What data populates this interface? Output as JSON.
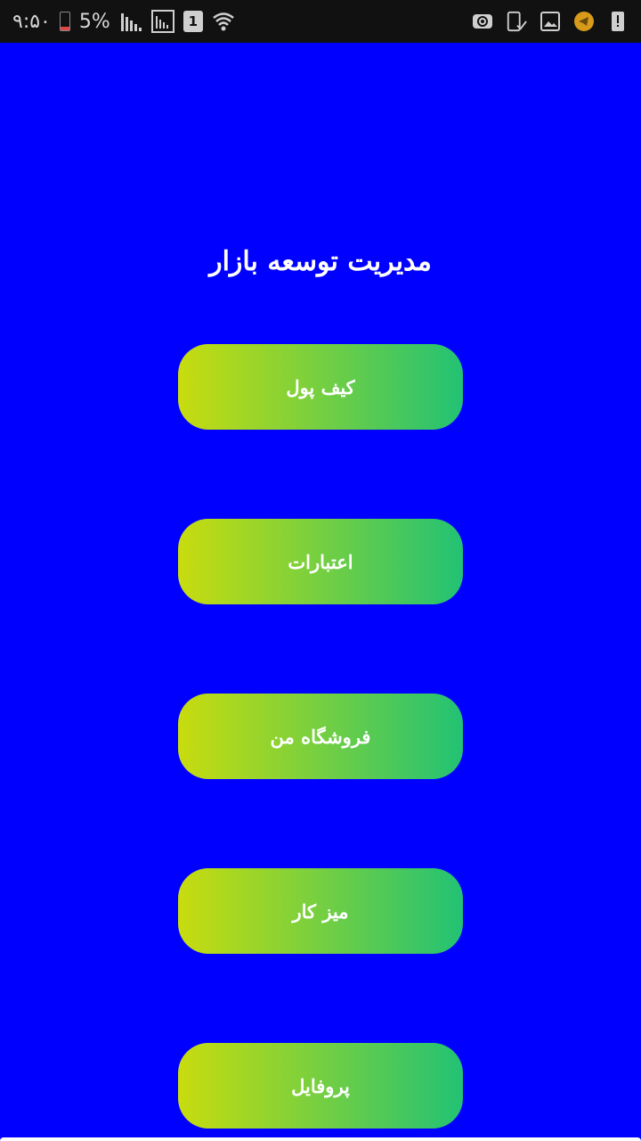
{
  "status_bar": {
    "time": "۹:۵۰",
    "battery_percent": "5%",
    "sim_slot": "1",
    "battery_level": 0.05,
    "icons": [
      "battery-icon",
      "signal-icon",
      "signal-box-icon",
      "sim-icon",
      "wifi-icon",
      "email-icon",
      "phone-check-icon",
      "gallery-icon",
      "telegram-icon",
      "alert-icon"
    ]
  },
  "main": {
    "title": "مدیریت توسعه بازار",
    "buttons": [
      {
        "label": "کیف پول"
      },
      {
        "label": "اعتبارات"
      },
      {
        "label": "فروشگاه من"
      },
      {
        "label": "میز کار"
      },
      {
        "label": "پروفایل"
      }
    ]
  },
  "colors": {
    "background": "#0000FF",
    "button_gradient_start": "#c8dc0e",
    "button_gradient_end": "#22c274",
    "text": "#ffffff"
  }
}
